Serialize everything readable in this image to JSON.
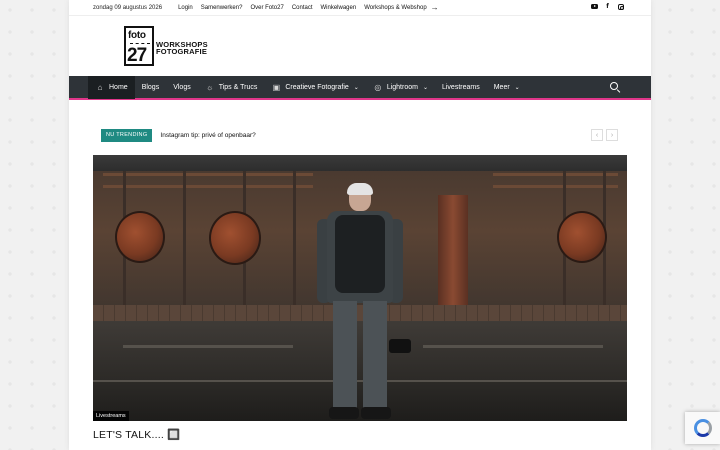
{
  "topbar": {
    "date": "zondag 09 augustus 2026",
    "links": [
      "Login",
      "Samenwerken?",
      "Over Foto27",
      "Contact",
      "Winkelwagen"
    ],
    "shop_link": "Workshops & Webshop",
    "shop_arrow": "→",
    "social": [
      "youtube-icon",
      "facebook-icon",
      "instagram-icon"
    ]
  },
  "logo": {
    "word_top": "foto",
    "number": "27",
    "line1": "WORKSHOPS",
    "line2": "FOTOGRAFIE"
  },
  "nav": {
    "items": [
      {
        "label": "Home",
        "icon": "home-icon",
        "active": true
      },
      {
        "label": "Blogs"
      },
      {
        "label": "Vlogs"
      },
      {
        "label": "Tips & Trucs",
        "icon": "lightbulb-icon"
      },
      {
        "label": "Creatieve Fotografie",
        "icon": "camera-icon",
        "dropdown": true
      },
      {
        "label": "Lightroom",
        "icon": "aperture-icon",
        "dropdown": true
      },
      {
        "label": "Livestreams"
      },
      {
        "label": "Meer",
        "dropdown": true
      }
    ],
    "accent_color": "#e0368a",
    "bar_color": "#2e3338"
  },
  "trending": {
    "tag": "NU TRENDING",
    "text": "Instagram tip: privé of openbaar?",
    "prev": "‹",
    "next": "›",
    "tag_color": "#1f8a82"
  },
  "hero": {
    "category": "Livestreams"
  },
  "post": {
    "title": "LET'S TALK.... 🔲"
  }
}
